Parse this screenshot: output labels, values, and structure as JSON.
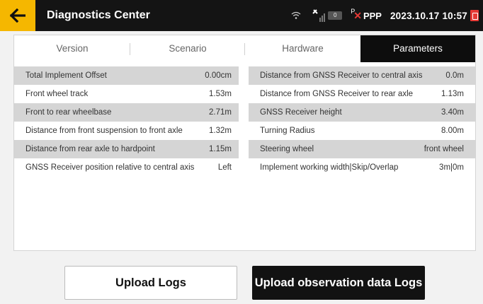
{
  "header": {
    "title": "Diagnostics Center",
    "satellite_count": "0",
    "correction_prefix": "P",
    "ppp_label": "PPP",
    "datetime": "2023.10.17 10:57",
    "back_icon": "arrow-left-icon",
    "accent_color": "#f5b700"
  },
  "tabs": [
    {
      "label": "Version"
    },
    {
      "label": "Scenario"
    },
    {
      "label": "Hardware"
    },
    {
      "label": "Parameters",
      "active": true
    }
  ],
  "parameters": {
    "left": [
      {
        "label": "Total Implement Offset",
        "value": "0.00cm"
      },
      {
        "label": "Front wheel track",
        "value": "1.53m"
      },
      {
        "label": "Front to rear wheelbase",
        "value": "2.71m"
      },
      {
        "label": "Distance from front suspension to front axle",
        "value": "1.32m"
      },
      {
        "label": "Distance from rear axle to hardpoint",
        "value": "1.15m"
      },
      {
        "label": "GNSS Receiver position relative to central axis",
        "value": "Left"
      }
    ],
    "right": [
      {
        "label": "Distance from GNSS Receiver to central axis",
        "value": "0.0m"
      },
      {
        "label": "Distance from GNSS Receiver to rear axle",
        "value": "1.13m"
      },
      {
        "label": "GNSS Receiver height",
        "value": "3.40m"
      },
      {
        "label": "Turning Radius",
        "value": "8.00m"
      },
      {
        "label": "Steering wheel",
        "value": "front wheel"
      },
      {
        "label": "Implement working width|Skip/Overlap",
        "value": "3m|0m"
      }
    ]
  },
  "actions": {
    "upload_logs": "Upload Logs",
    "upload_observation_logs": "Upload observation data Logs"
  }
}
